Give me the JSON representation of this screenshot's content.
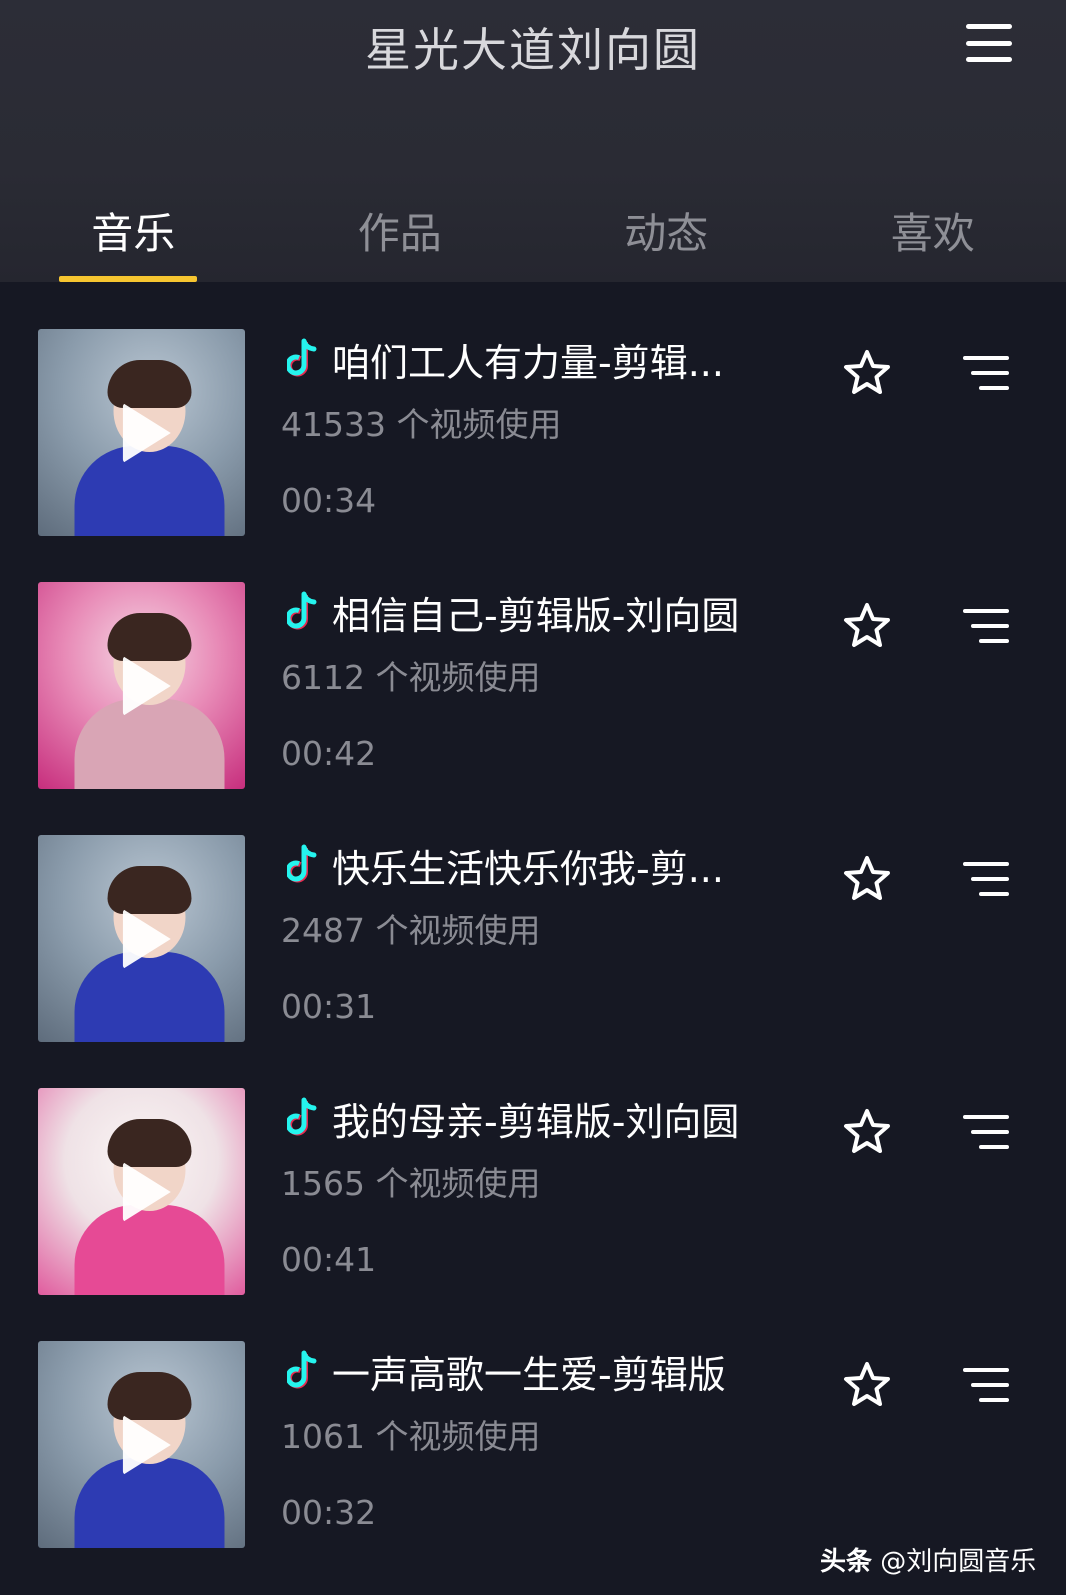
{
  "header": {
    "title": "星光大道刘向圆"
  },
  "tabs": [
    {
      "label": "音乐",
      "active": true
    },
    {
      "label": "作品",
      "active": false
    },
    {
      "label": "动态",
      "active": false
    },
    {
      "label": "喜欢",
      "active": false
    }
  ],
  "songs": [
    {
      "title": "咱们工人有力量-剪辑...",
      "usage": "41533 个视频使用",
      "duration": "00:34"
    },
    {
      "title": "相信自己-剪辑版-刘向圆",
      "usage": "6112 个视频使用",
      "duration": "00:42"
    },
    {
      "title": "快乐生活快乐你我-剪...",
      "usage": "2487 个视频使用",
      "duration": "00:31"
    },
    {
      "title": "我的母亲-剪辑版-刘向圆",
      "usage": "1565 个视频使用",
      "duration": "00:41"
    },
    {
      "title": "一声高歌一生爱-剪辑版",
      "usage": "1061 个视频使用",
      "duration": "00:32"
    }
  ],
  "watermark": {
    "brand": "头条",
    "handle": "@刘向圆音乐"
  },
  "colors": {
    "background": "#161823",
    "tab_indicator": "#f6c530",
    "note_cyan": "#25f4ee",
    "note_red": "#fe2c55"
  },
  "icons": {
    "menu": "hamburger-icon",
    "note": "music-note-icon",
    "star": "star-outline-icon",
    "more": "playlist-menu-icon",
    "play": "play-icon"
  }
}
